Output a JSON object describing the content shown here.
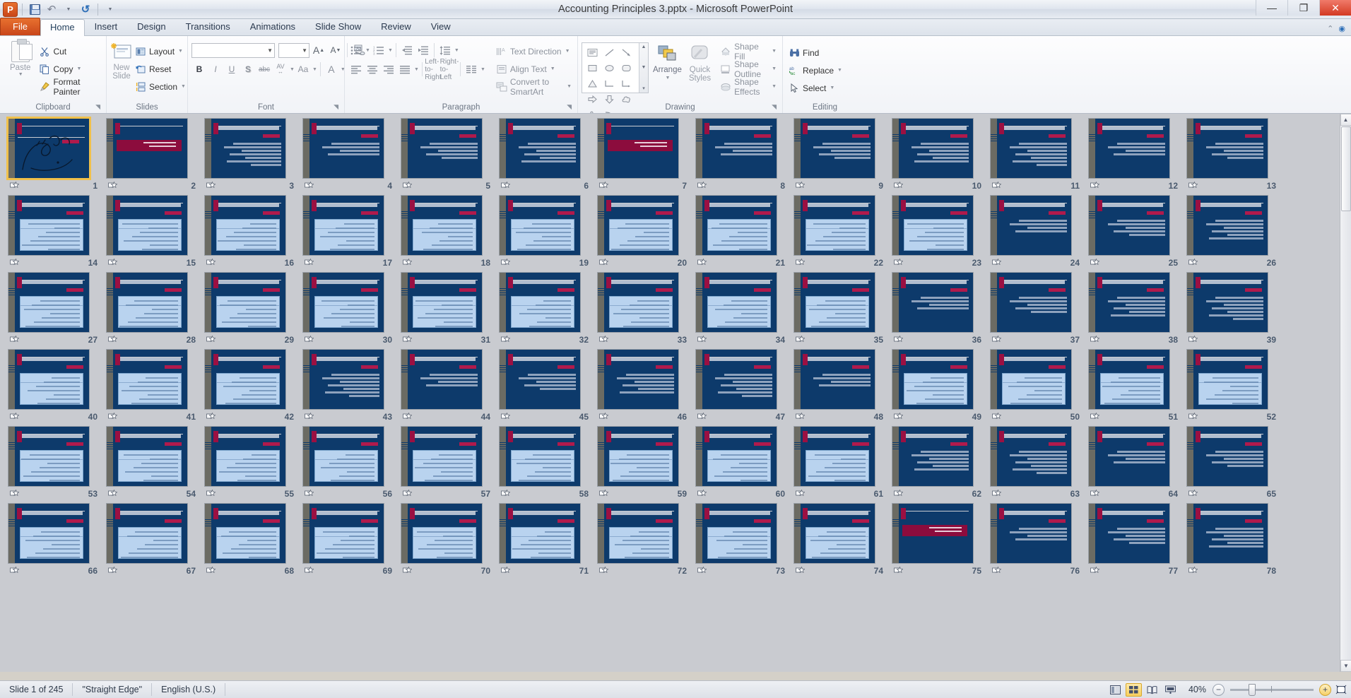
{
  "window": {
    "title": "Accounting Principles 3.pptx  -  Microsoft PowerPoint",
    "quick_access": [
      {
        "name": "powerpoint-logo",
        "label": "P"
      },
      {
        "name": "save",
        "label": "Save"
      },
      {
        "name": "undo",
        "label": "Undo"
      },
      {
        "name": "redo",
        "label": "Redo"
      },
      {
        "name": "customize-qat",
        "label": "Customize Quick Access Toolbar"
      }
    ],
    "controls": {
      "minimize": "—",
      "restore": "❐",
      "close": "✕"
    }
  },
  "tabs": [
    {
      "label": "File",
      "type": "file"
    },
    {
      "label": "Home",
      "type": "active"
    },
    {
      "label": "Insert",
      "type": "normal"
    },
    {
      "label": "Design",
      "type": "normal"
    },
    {
      "label": "Transitions",
      "type": "normal"
    },
    {
      "label": "Animations",
      "type": "normal"
    },
    {
      "label": "Slide Show",
      "type": "normal"
    },
    {
      "label": "Review",
      "type": "normal"
    },
    {
      "label": "View",
      "type": "normal"
    }
  ],
  "ribbon": {
    "groups": [
      {
        "name": "clipboard",
        "label": "Clipboard",
        "has_launcher": true
      },
      {
        "name": "slides",
        "label": "Slides",
        "has_launcher": false
      },
      {
        "name": "font",
        "label": "Font",
        "has_launcher": true
      },
      {
        "name": "paragraph",
        "label": "Paragraph",
        "has_launcher": true
      },
      {
        "name": "drawing",
        "label": "Drawing",
        "has_launcher": true
      },
      {
        "name": "editing",
        "label": "Editing",
        "has_launcher": false
      }
    ],
    "clipboard": {
      "paste": "Paste",
      "cut": "Cut",
      "copy": "Copy",
      "format_painter": "Format Painter"
    },
    "slides": {
      "new_slide_line1": "New",
      "new_slide_line2": "Slide",
      "layout": "Layout",
      "reset": "Reset",
      "section": "Section"
    },
    "font": {
      "font_name_value": "",
      "font_name_placeholder": "",
      "font_size_value": "",
      "bold": "B",
      "italic": "I",
      "underline": "U",
      "shadow": "S",
      "strikethrough": "abc",
      "char_spacing": "AV",
      "change_case": "Aa",
      "font_color": "A",
      "grow_font": "A",
      "shrink_font": "A",
      "clear_formatting": "Aa"
    },
    "paragraph": {
      "bullets": "Bullets",
      "numbering": "Numbering",
      "decrease_indent": "Decrease List Level",
      "increase_indent": "Increase List Level",
      "line_spacing": "Line Spacing",
      "align_left": "Align Text Left",
      "align_center": "Center",
      "align_right": "Align Text Right",
      "justify": "Justify",
      "ltr": "Left-to-Right",
      "rtl": "Right-to-Left",
      "columns": "Columns",
      "text_direction": "Text Direction",
      "align_text": "Align Text",
      "convert_to_smartart": "Convert to SmartArt"
    },
    "drawing": {
      "arrange": "Arrange",
      "quick_styles_line1": "Quick",
      "quick_styles_line2": "Styles",
      "shape_fill": "Shape Fill",
      "shape_outline": "Shape Outline",
      "shape_effects": "Shape Effects",
      "shape_gallery": [
        "text-box",
        "line",
        "arrow",
        "rectangle",
        "oval",
        "rounded-rectangle",
        "triangle",
        "elbow-connector",
        "elbow-arrow-connector",
        "right-arrow",
        "down-arrow",
        "cloud",
        "scribble",
        "curve",
        "arc",
        "left-brace",
        "right-brace",
        "star"
      ]
    },
    "editing": {
      "find": "Find",
      "replace": "Replace",
      "select": "Select"
    }
  },
  "statusbar": {
    "slide_indicator": "Slide 1 of 245",
    "theme": "\"Straight Edge\"",
    "language": "English (U.S.)",
    "views": [
      {
        "name": "normal-view",
        "label": "Normal",
        "active": false
      },
      {
        "name": "slide-sorter-view",
        "label": "Slide Sorter",
        "active": true
      },
      {
        "name": "reading-view",
        "label": "Reading View",
        "active": false
      },
      {
        "name": "slide-show-view",
        "label": "Slide Show",
        "active": false
      }
    ],
    "zoom_percent": "40%",
    "zoom_out": "−",
    "zoom_in": "+",
    "fit_to_window": "Fit slide to current window"
  },
  "sorter": {
    "selected_slide": 1,
    "total_slides": 245,
    "columns": 13,
    "colors": {
      "slide_bg": "#0d3a6b",
      "accent_magenta": "#8c0c3d",
      "panel_blue": "#b9d3ef",
      "left_strip": "#6b6b63",
      "selection": "#f0c04a"
    },
    "slides": [
      {
        "n": 1,
        "kind": "title-calligraphy"
      },
      {
        "n": 2,
        "kind": "band"
      },
      {
        "n": 3,
        "kind": "bullets"
      },
      {
        "n": 4,
        "kind": "bullets"
      },
      {
        "n": 5,
        "kind": "bullets"
      },
      {
        "n": 6,
        "kind": "bullets"
      },
      {
        "n": 7,
        "kind": "band"
      },
      {
        "n": 8,
        "kind": "bullets"
      },
      {
        "n": 9,
        "kind": "bullets"
      },
      {
        "n": 10,
        "kind": "bullets"
      },
      {
        "n": 11,
        "kind": "bullets"
      },
      {
        "n": 12,
        "kind": "bullets"
      },
      {
        "n": 13,
        "kind": "bullets"
      },
      {
        "n": 14,
        "kind": "panel"
      },
      {
        "n": 15,
        "kind": "panel"
      },
      {
        "n": 16,
        "kind": "panel"
      },
      {
        "n": 17,
        "kind": "panel"
      },
      {
        "n": 18,
        "kind": "panel"
      },
      {
        "n": 19,
        "kind": "panel"
      },
      {
        "n": 20,
        "kind": "panel"
      },
      {
        "n": 21,
        "kind": "panel"
      },
      {
        "n": 22,
        "kind": "panel"
      },
      {
        "n": 23,
        "kind": "panel"
      },
      {
        "n": 24,
        "kind": "bullets"
      },
      {
        "n": 25,
        "kind": "bullets"
      },
      {
        "n": 26,
        "kind": "bullets"
      },
      {
        "n": 27,
        "kind": "panel"
      },
      {
        "n": 28,
        "kind": "panel"
      },
      {
        "n": 29,
        "kind": "panel"
      },
      {
        "n": 30,
        "kind": "panel"
      },
      {
        "n": 31,
        "kind": "panel"
      },
      {
        "n": 32,
        "kind": "panel"
      },
      {
        "n": 33,
        "kind": "panel"
      },
      {
        "n": 34,
        "kind": "panel"
      },
      {
        "n": 35,
        "kind": "panel"
      },
      {
        "n": 36,
        "kind": "bullets"
      },
      {
        "n": 37,
        "kind": "bullets"
      },
      {
        "n": 38,
        "kind": "bullets"
      },
      {
        "n": 39,
        "kind": "bullets"
      },
      {
        "n": 40,
        "kind": "panel"
      },
      {
        "n": 41,
        "kind": "panel"
      },
      {
        "n": 42,
        "kind": "panel"
      },
      {
        "n": 43,
        "kind": "bullets"
      },
      {
        "n": 44,
        "kind": "bullets"
      },
      {
        "n": 45,
        "kind": "bullets"
      },
      {
        "n": 46,
        "kind": "bullets"
      },
      {
        "n": 47,
        "kind": "bullets"
      },
      {
        "n": 48,
        "kind": "bullets"
      },
      {
        "n": 49,
        "kind": "panel"
      },
      {
        "n": 50,
        "kind": "panel"
      },
      {
        "n": 51,
        "kind": "panel"
      },
      {
        "n": 52,
        "kind": "panel"
      },
      {
        "n": 53,
        "kind": "panel"
      },
      {
        "n": 54,
        "kind": "panel"
      },
      {
        "n": 55,
        "kind": "panel"
      },
      {
        "n": 56,
        "kind": "panel"
      },
      {
        "n": 57,
        "kind": "panel"
      },
      {
        "n": 58,
        "kind": "panel"
      },
      {
        "n": 59,
        "kind": "panel"
      },
      {
        "n": 60,
        "kind": "panel"
      },
      {
        "n": 61,
        "kind": "panel"
      },
      {
        "n": 62,
        "kind": "bullets"
      },
      {
        "n": 63,
        "kind": "bullets"
      },
      {
        "n": 64,
        "kind": "bullets"
      },
      {
        "n": 65,
        "kind": "bullets"
      },
      {
        "n": 66,
        "kind": "panel"
      },
      {
        "n": 67,
        "kind": "panel"
      },
      {
        "n": 68,
        "kind": "panel"
      },
      {
        "n": 69,
        "kind": "panel"
      },
      {
        "n": 70,
        "kind": "panel"
      },
      {
        "n": 71,
        "kind": "panel"
      },
      {
        "n": 72,
        "kind": "panel"
      },
      {
        "n": 73,
        "kind": "panel"
      },
      {
        "n": 74,
        "kind": "panel"
      },
      {
        "n": 75,
        "kind": "band"
      },
      {
        "n": 76,
        "kind": "bullets"
      },
      {
        "n": 77,
        "kind": "bullets"
      },
      {
        "n": 78,
        "kind": "bullets"
      }
    ]
  }
}
